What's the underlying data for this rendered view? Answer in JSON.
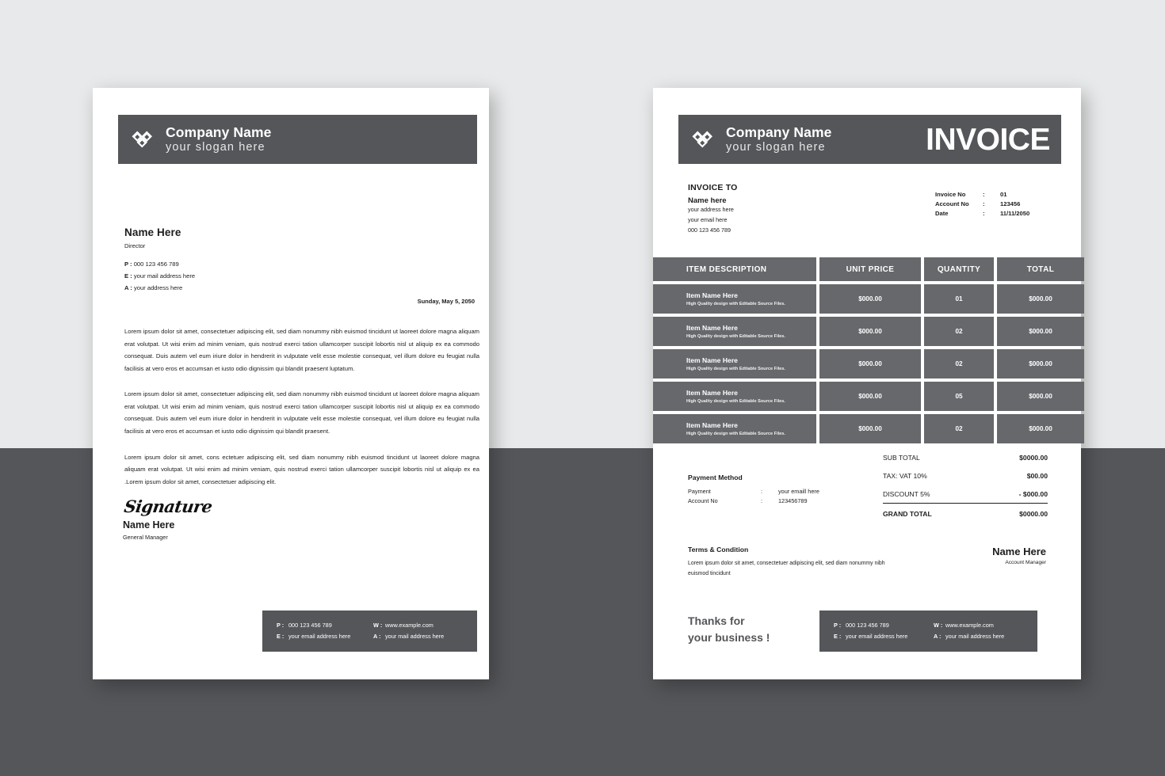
{
  "theme": {
    "dark": "#545659",
    "table_cell": "#66686b",
    "bg_top": "#e8e9ea",
    "bg_bottom": "#545659",
    "paper": "#ffffff"
  },
  "brand": {
    "name": "Company Name",
    "slogan": "your slogan here",
    "logo_icon": "double-diamond-logo-icon"
  },
  "letterhead": {
    "recipient": {
      "name": "Name Here",
      "role": "Director"
    },
    "contact": [
      {
        "key": "P :",
        "value": "000 123 456 789"
      },
      {
        "key": "E :",
        "value": "your mail address here"
      },
      {
        "key": "A :",
        "value": "your address here"
      }
    ],
    "date": "Sunday, May 5, 2050",
    "paragraphs": [
      "Lorem ipsum dolor sit amet, consectetuer adipiscing elit, sed diam nonummy nibh euismod tincidunt ut laoreet dolore magna aliquam erat volutpat. Ut wisi enim ad minim veniam, quis nostrud exerci tation ullamcorper suscipit lobortis nisl ut aliquip ex ea commodo consequat. Duis autem vel eum iriure dolor in hendrerit in vulputate velit esse molestie consequat, vel illum dolore eu feugiat nulla facilisis at vero eros et accumsan et iusto odio dignissim qui blandit praesent luptatum.",
      "Lorem ipsum dolor sit amet, consectetuer adipiscing elit, sed diam nonummy nibh euismod tincidunt ut laoreet dolore magna aliquam erat volutpat. Ut wisi enim ad minim veniam, quis nostrud exerci tation ullamcorper suscipit lobortis nisl ut aliquip ex ea commodo consequat. Duis autem vel eum iriure dolor in hendrerit in vulputate velit esse molestie consequat, vel illum dolore eu feugiat nulla facilisis at vero eros et accumsan et iusto odio dignissim qui blandit praesent.",
      "Lorem ipsum dolor sit amet, cons ectetuer adipiscing elit, sed diam nonummy nibh euismod tincidunt ut laoreet dolore magna aliquam erat volutpat. Ut wisi enim ad minim veniam, quis nostrud exerci tation ullamcorper suscipit lobortis nisl ut aliquip ex ea .Lorem ipsum dolor sit amet, consectetuer adipiscing elit."
    ],
    "signature": {
      "script": "Signature",
      "name": "Name Here",
      "role": "General Manager"
    },
    "footer": {
      "left": [
        {
          "key": "P :",
          "value": "000 123 456 789"
        },
        {
          "key": "E :",
          "value": "your email address here"
        }
      ],
      "right": [
        {
          "key": "W :",
          "value": "www.example.com"
        },
        {
          "key": "A :",
          "value": "your mail address here"
        }
      ]
    }
  },
  "invoice": {
    "title": "INVOICE",
    "invoice_to": {
      "heading": "INVOICE TO",
      "name": "Name here",
      "address": "your address here",
      "email": "your email here",
      "phone": "000 123 456 789"
    },
    "meta": [
      {
        "key": "Invoice No",
        "sep": ":",
        "value": "01"
      },
      {
        "key": "Account No",
        "sep": ":",
        "value": "123456"
      },
      {
        "key": "Date",
        "sep": ":",
        "value": "11/11/2050"
      }
    ],
    "table": {
      "columns": [
        "ITEM DESCRIPTION",
        "UNIT PRICE",
        "QUANTITY",
        "TOTAL"
      ],
      "rows": [
        {
          "name": "Item Name Here",
          "sub": "High Quality design with Editable Source Files.",
          "price": "$000.00",
          "qty": "01",
          "total": "$000.00"
        },
        {
          "name": "Item Name Here",
          "sub": "High Quality design with Editable Source Files.",
          "price": "$000.00",
          "qty": "02",
          "total": "$000.00"
        },
        {
          "name": "Item Name Here",
          "sub": "High Quality design with Editable Source Files.",
          "price": "$000.00",
          "qty": "02",
          "total": "$000.00"
        },
        {
          "name": "Item Name Here",
          "sub": "High Quality design with Editable Source Files.",
          "price": "$000.00",
          "qty": "05",
          "total": "$000.00"
        },
        {
          "name": "Item Name Here",
          "sub": "High Quality design with Editable Source Files.",
          "price": "$000.00",
          "qty": "02",
          "total": "$000.00"
        }
      ]
    },
    "payment": {
      "title": "Payment Method",
      "rows": [
        {
          "key": "Payment",
          "sep": ":",
          "value": "your emaill here"
        },
        {
          "key": "Account No",
          "sep": ":",
          "value": "123456789"
        }
      ]
    },
    "totals": [
      {
        "label": "SUB TOTAL",
        "value": "$0000.00"
      },
      {
        "label": "TAX: VAT 10%",
        "value": "$00.00"
      },
      {
        "label": "DISCOUNT 5%",
        "value": "- $000.00"
      },
      {
        "label": "GRAND TOTAL",
        "value": "$0000.00"
      }
    ],
    "terms": {
      "title": "Terms & Condition",
      "body": "Lorem ipsum dolor sit amet, consectetuer adipiscing elit, sed diam nonummy nibh euismod tincidunt"
    },
    "signer": {
      "name": "Name Here",
      "role": "Account Manager"
    },
    "thanks": "Thanks for\nyour business !",
    "footer": {
      "left": [
        {
          "key": "P :",
          "value": "000 123 456 789"
        },
        {
          "key": "E :",
          "value": "your email address here"
        }
      ],
      "right": [
        {
          "key": "W :",
          "value": "www.example.com"
        },
        {
          "key": "A :",
          "value": "your mail address here"
        }
      ]
    }
  }
}
